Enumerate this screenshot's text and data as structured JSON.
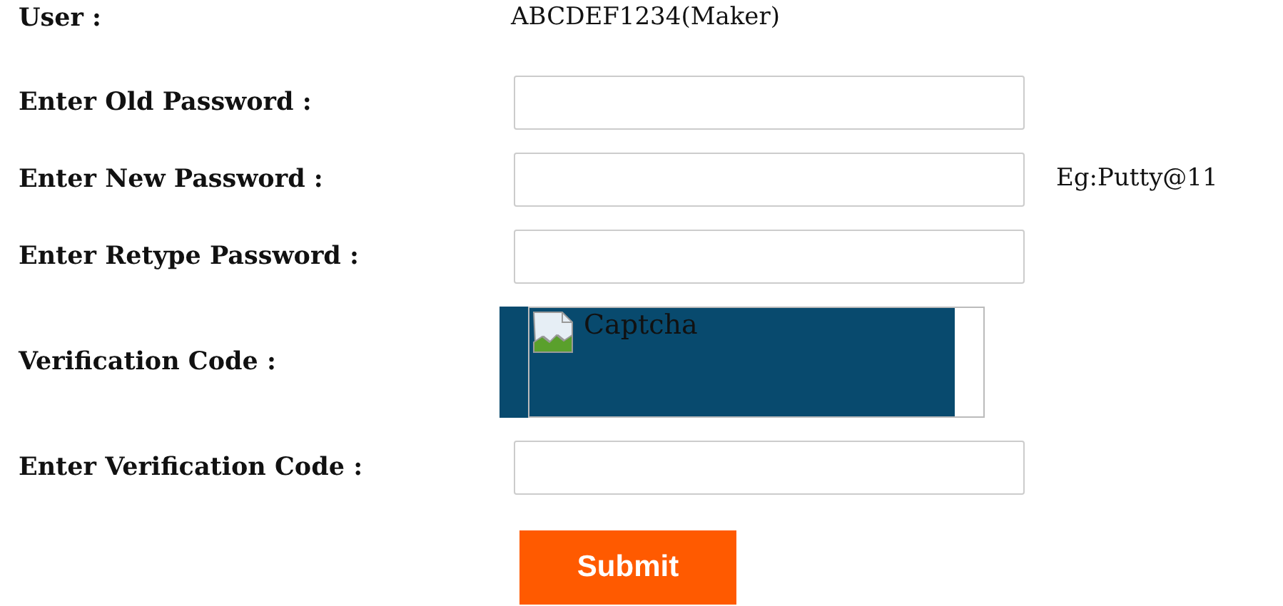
{
  "form": {
    "rows": [
      {
        "kind": "text",
        "label": "User :",
        "value": "ABCDEF1234(Maker)"
      },
      {
        "kind": "input",
        "label": "Enter Old Password :"
      },
      {
        "kind": "input",
        "label": "Enter New Password :",
        "hint": "Eg:Putty@11"
      },
      {
        "kind": "input",
        "label": "Enter Retype Password :"
      },
      {
        "kind": "captcha",
        "label": "Verification Code :",
        "alt": "Captcha"
      },
      {
        "kind": "input",
        "label": "Enter Verification Code :"
      }
    ],
    "submit": "Submit"
  }
}
